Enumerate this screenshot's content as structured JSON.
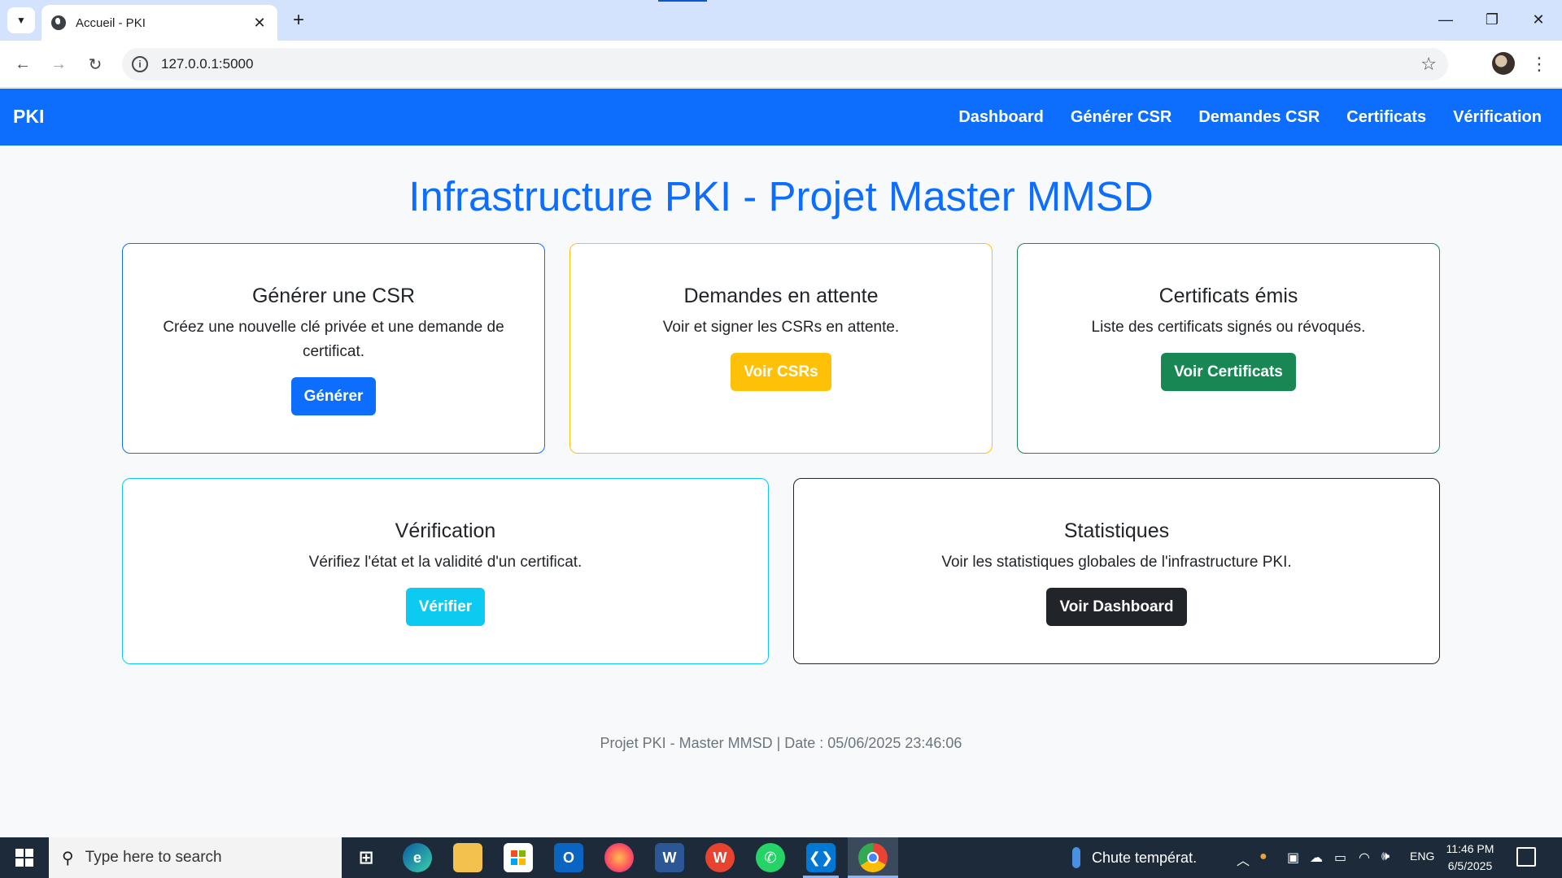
{
  "browser": {
    "tab_title": "Accueil - PKI",
    "url": "127.0.0.1:5000"
  },
  "navbar": {
    "brand": "PKI",
    "links": [
      "Dashboard",
      "Générer CSR",
      "Demandes CSR",
      "Certificats",
      "Vérification"
    ]
  },
  "page": {
    "title": "Infrastructure PKI - Projet Master MMSD"
  },
  "cards": [
    {
      "title": "Générer une CSR",
      "text": "Créez une nouvelle clé privée et une demande de certificat.",
      "button": "Générer",
      "accent": "#0d6efd"
    },
    {
      "title": "Demandes en attente",
      "text": "Voir et signer les CSRs en attente.",
      "button": "Voir CSRs",
      "accent": "#ffc107"
    },
    {
      "title": "Certificats émis",
      "text": "Liste des certificats signés ou révoqués.",
      "button": "Voir Certificats",
      "accent": "#198754"
    },
    {
      "title": "Vérification",
      "text": "Vérifiez l'état et la validité d'un certificat.",
      "button": "Vérifier",
      "accent": "#0dcaf0"
    },
    {
      "title": "Statistiques",
      "text": "Voir les statistiques globales de l'infrastructure PKI.",
      "button": "Voir Dashboard",
      "accent": "#212529"
    }
  ],
  "footer": {
    "text": "Projet PKI - Master MMSD | Date : 05/06/2025 23:46:06"
  },
  "taskbar": {
    "search_placeholder": "Type here to search",
    "weather": "Chute températ.",
    "language": "ENG",
    "time": "11:46 PM",
    "date": "6/5/2025",
    "apps": [
      "task-view",
      "edge",
      "file-explorer",
      "microsoft-store",
      "outlook",
      "firefox",
      "word",
      "wps-office",
      "whatsapp",
      "vscode",
      "chrome"
    ]
  }
}
